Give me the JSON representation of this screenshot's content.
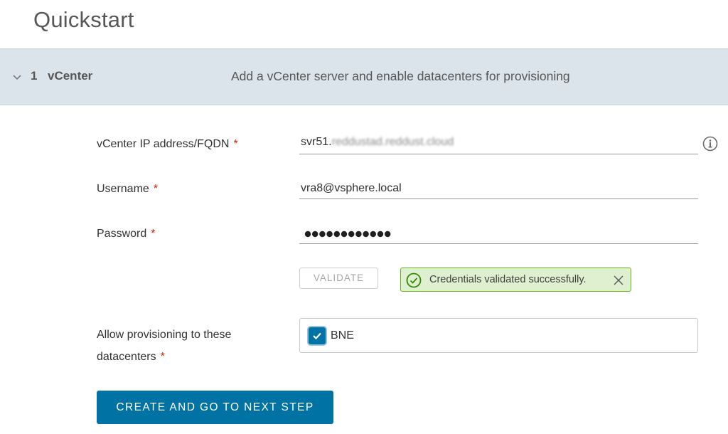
{
  "page": {
    "title": "Quickstart"
  },
  "step": {
    "number": "1",
    "name": "vCenter",
    "description": "Add a vCenter server and enable datacenters for provisioning"
  },
  "form": {
    "fqdn": {
      "label": "vCenter IP address/FQDN",
      "required_marker": "*",
      "value_prefix": "svr51.",
      "value_obscured": "reddustad.reddust.cloud"
    },
    "username": {
      "label": "Username",
      "required_marker": "*",
      "value": "vra8@vsphere.local"
    },
    "password": {
      "label": "Password",
      "required_marker": "*",
      "masked_length": 12
    },
    "validate_label": "VALIDATE",
    "alert": {
      "message": "Credentials validated successfully."
    },
    "datacenters": {
      "label_line1": "Allow provisioning to these",
      "label_line2": "datacenters",
      "required_marker": "*",
      "items": [
        {
          "name": "BNE",
          "checked": true
        }
      ]
    },
    "submit_label": "CREATE AND GO TO NEXT STEP"
  },
  "colors": {
    "primary": "#0072a3",
    "success_border": "#5eb715",
    "success_bg": "#dff0d0",
    "required": "#c92100",
    "header_bg": "#dbe4ea"
  },
  "icons": {
    "step_toggle": "chevron-down-icon",
    "info": "info-icon",
    "success": "check-circle-icon",
    "close": "close-icon",
    "checkbox": "checkmark-icon"
  }
}
